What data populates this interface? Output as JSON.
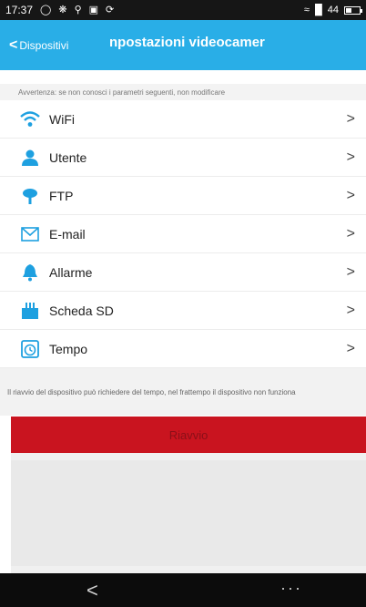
{
  "status_bar": {
    "time": "17:37",
    "signal_text": "44"
  },
  "header": {
    "back_label": "Dispositivi",
    "title": "npostazioni videocamer"
  },
  "warning_text": "Avvertenza: se non conosci i parametri seguenti, non modificare",
  "settings": [
    {
      "label": "WiFi",
      "icon": "wifi-icon"
    },
    {
      "label": "Utente",
      "icon": "user-icon"
    },
    {
      "label": "FTP",
      "icon": "ftp-icon"
    },
    {
      "label": "E-mail",
      "icon": "email-icon"
    },
    {
      "label": "Allarme",
      "icon": "alarm-icon"
    },
    {
      "label": "Scheda SD",
      "icon": "sd-card-icon"
    },
    {
      "label": "Tempo",
      "icon": "clock-icon"
    }
  ],
  "reboot_note": "Il riavvio del dispositivo può richiedere del tempo, nel frattempo il dispositivo non funziona",
  "reboot_button": "Riavvio",
  "arrow_glyph": ">",
  "colors": {
    "header": "#29aee7",
    "icon_blue": "#1ea0e0",
    "reboot": "#c9141f"
  }
}
